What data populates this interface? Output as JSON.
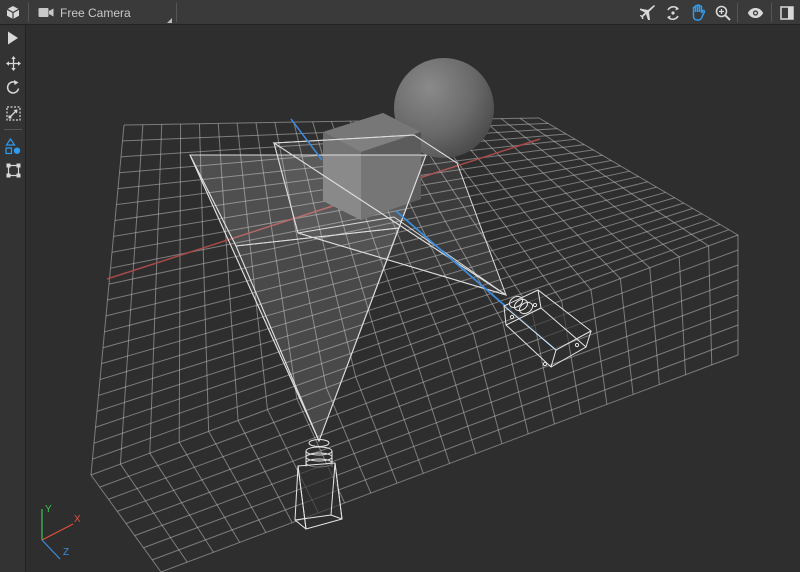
{
  "toolbar": {
    "camera_label": "Free Camera",
    "buttons": [
      {
        "name": "fly-mode-icon",
        "active": false
      },
      {
        "name": "orbit-mode-icon",
        "active": false
      },
      {
        "name": "pan-hand-icon",
        "active": true
      },
      {
        "name": "zoom-icon",
        "active": false
      },
      {
        "name": "visibility-eye-icon",
        "active": false
      },
      {
        "name": "panel-toggle-icon",
        "active": false
      }
    ]
  },
  "sidebar": {
    "tools": [
      {
        "name": "select-tool",
        "active": false
      },
      {
        "name": "move-tool",
        "active": false
      },
      {
        "name": "rotate-tool",
        "active": false
      },
      {
        "name": "scale-tool",
        "active": false
      },
      {
        "name": "shapes-tool",
        "active": true
      },
      {
        "name": "bounding-box-tool",
        "active": false
      }
    ]
  },
  "gizmo": {
    "x_label": "X",
    "y_label": "Y",
    "z_label": "Z",
    "x_color": "#e0503c",
    "y_color": "#3cc450",
    "z_color": "#3c8cdc"
  },
  "colors": {
    "accent": "#2d9cf0",
    "toolbar_bg": "#3a3a3a",
    "viewport_bg": "#2e2e2e"
  }
}
